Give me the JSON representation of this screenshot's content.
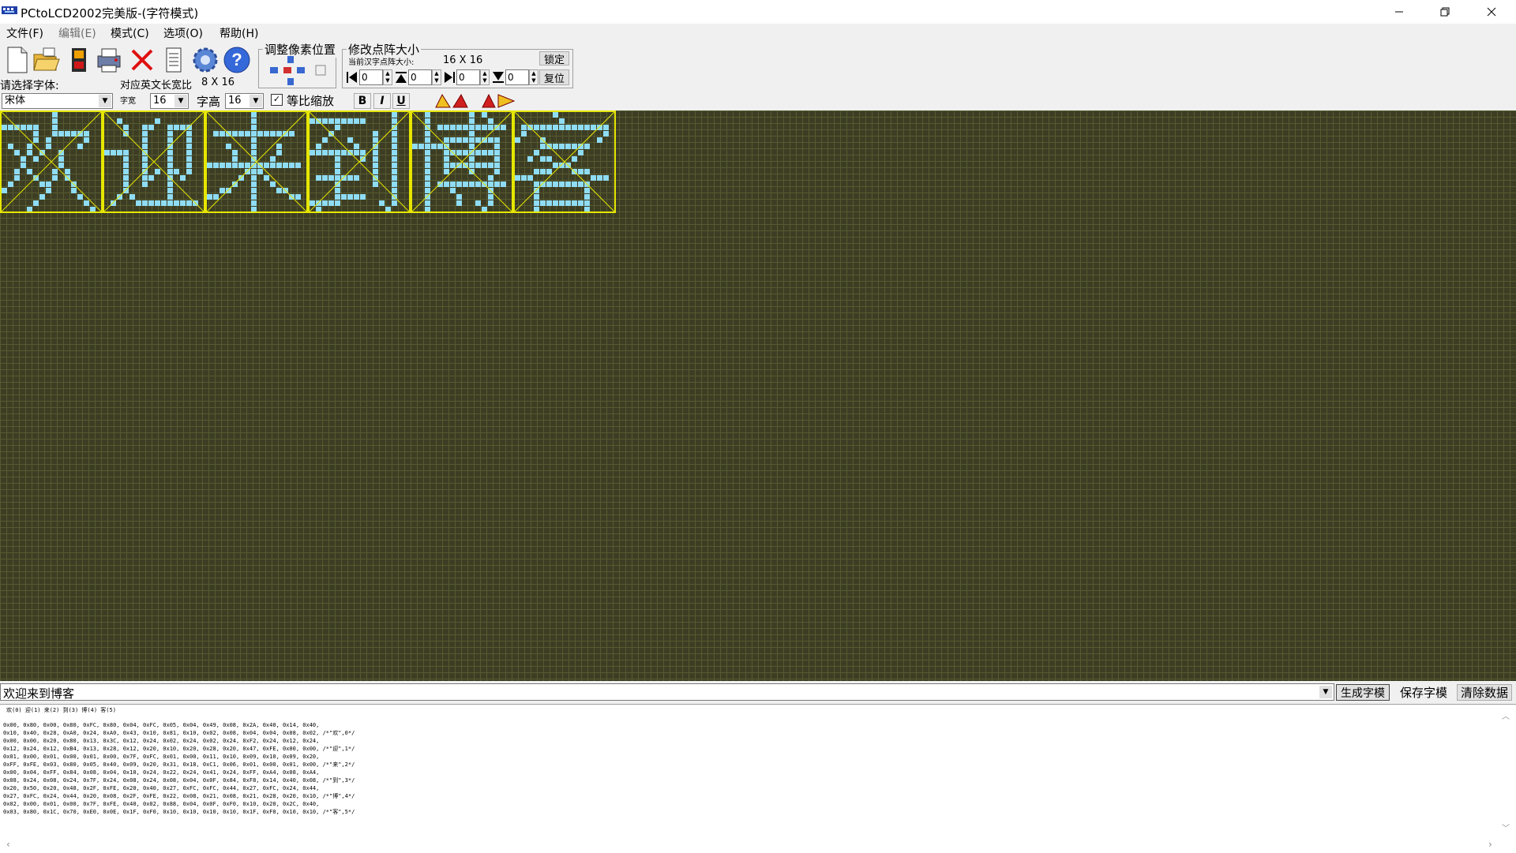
{
  "window": {
    "title": "PCtoLCD2002完美版-(字符模式)",
    "minimize_glyph": "—",
    "maximize_glyph": "❐",
    "close_glyph": "✕"
  },
  "menu": [
    {
      "label": "文件(F)",
      "enabled": true
    },
    {
      "label": "编辑(E)",
      "enabled": false
    },
    {
      "label": "模式(C)",
      "enabled": true
    },
    {
      "label": "选项(O)",
      "enabled": true
    },
    {
      "label": "帮助(H)",
      "enabled": true
    }
  ],
  "toolbar": {
    "icons": [
      "new-file-icon",
      "open-folder-icon",
      "save-disk-icon",
      "print-icon",
      "delete-icon",
      "document-icon",
      "settings-gear-icon",
      "help-icon"
    ],
    "font_label": "请选择字体:",
    "font_value": "宋体",
    "ratio_label": "对应英文长宽比",
    "ratio_value": "8 X 16",
    "width_label": "字宽",
    "width_value": "16",
    "height_label": "字高",
    "height_value": "16",
    "proportional_label": "等比缩放",
    "proportional_checked": true,
    "bold": "B",
    "italic": "I",
    "underline": "U"
  },
  "pixel_adjust": {
    "title": "调整像素位置"
  },
  "matrix": {
    "title": "修改点阵大小",
    "current_label": "当前汉字点阵大小:",
    "current_value": "16 X 16",
    "lock_label": "锁定",
    "reset_label": "复位",
    "spins": [
      "0",
      "0",
      "0",
      "0"
    ]
  },
  "canvas_chars": [
    "欢",
    "迎",
    "来",
    "到",
    "博",
    "客"
  ],
  "input": {
    "text": "欢迎来到博客",
    "generate_label": "生成字模",
    "save_label": "保存字模",
    "clear_label": "清除数据"
  },
  "output": {
    "index_line": "欢(0) 迎(1) 来(2) 到(3) 博(4) 客(5)",
    "lines": [
      "0x00, 0x80, 0x00, 0x80, 0xFC, 0x80, 0x04, 0xFC, 0x05, 0x04, 0x49, 0x08, 0x2A, 0x40, 0x14, 0x40,",
      "0x10, 0x40, 0x28, 0xA0, 0x24, 0xA0, 0x43, 0x10, 0x81, 0x10, 0x02, 0x08, 0x04, 0x04, 0x08, 0x02, /*\"欢\",0*/",
      "0x00, 0x00, 0x20, 0x80, 0x13, 0x3C, 0x12, 0x24, 0x02, 0x24, 0x02, 0x24, 0xF2, 0x24, 0x12, 0x24,",
      "0x12, 0x24, 0x12, 0xB4, 0x13, 0x28, 0x12, 0x20, 0x10, 0x20, 0x28, 0x20, 0x47, 0xFE, 0x00, 0x00, /*\"迎\",1*/",
      "0x01, 0x00, 0x01, 0x00, 0x01, 0x00, 0x7F, 0xFC, 0x01, 0x00, 0x11, 0x10, 0x09, 0x10, 0x09, 0x20,",
      "0xFF, 0xFE, 0x03, 0x80, 0x05, 0x40, 0x09, 0x20, 0x31, 0x18, 0xC1, 0x06, 0x01, 0x00, 0x01, 0x00, /*\"来\",2*/",
      "0x00, 0x04, 0xFF, 0x84, 0x08, 0x04, 0x10, 0x24, 0x22, 0x24, 0x41, 0x24, 0xFF, 0xA4, 0x08, 0xA4,",
      "0x08, 0x24, 0x08, 0x24, 0x7F, 0x24, 0x08, 0x24, 0x08, 0x04, 0x0F, 0x84, 0xF8, 0x14, 0x40, 0x08, /*\"到\",3*/",
      "0x20, 0x50, 0x20, 0x48, 0x2F, 0xFE, 0x20, 0x40, 0x27, 0xFC, 0xFC, 0x44, 0x27, 0xFC, 0x24, 0x44,",
      "0x27, 0xFC, 0x24, 0x44, 0x20, 0x08, 0x2F, 0xFE, 0x22, 0x08, 0x21, 0x08, 0x21, 0x28, 0x20, 0x10, /*\"博\",4*/",
      "0x02, 0x00, 0x01, 0x00, 0x7F, 0xFE, 0x40, 0x02, 0x88, 0x04, 0x0F, 0xF0, 0x10, 0x20, 0x2C, 0x40,",
      "0x03, 0x80, 0x1C, 0x70, 0xE0, 0x0E, 0x1F, 0xF0, 0x10, 0x10, 0x10, 0x10, 0x1F, 0xF0, 0x10, 0x10, /*\"客\",5*/"
    ]
  },
  "colors": {
    "grid_bg": "#3d3d24",
    "grid_line": "#565b30",
    "pixel_on": "#8fdcf5",
    "frame": "#e6e600"
  }
}
